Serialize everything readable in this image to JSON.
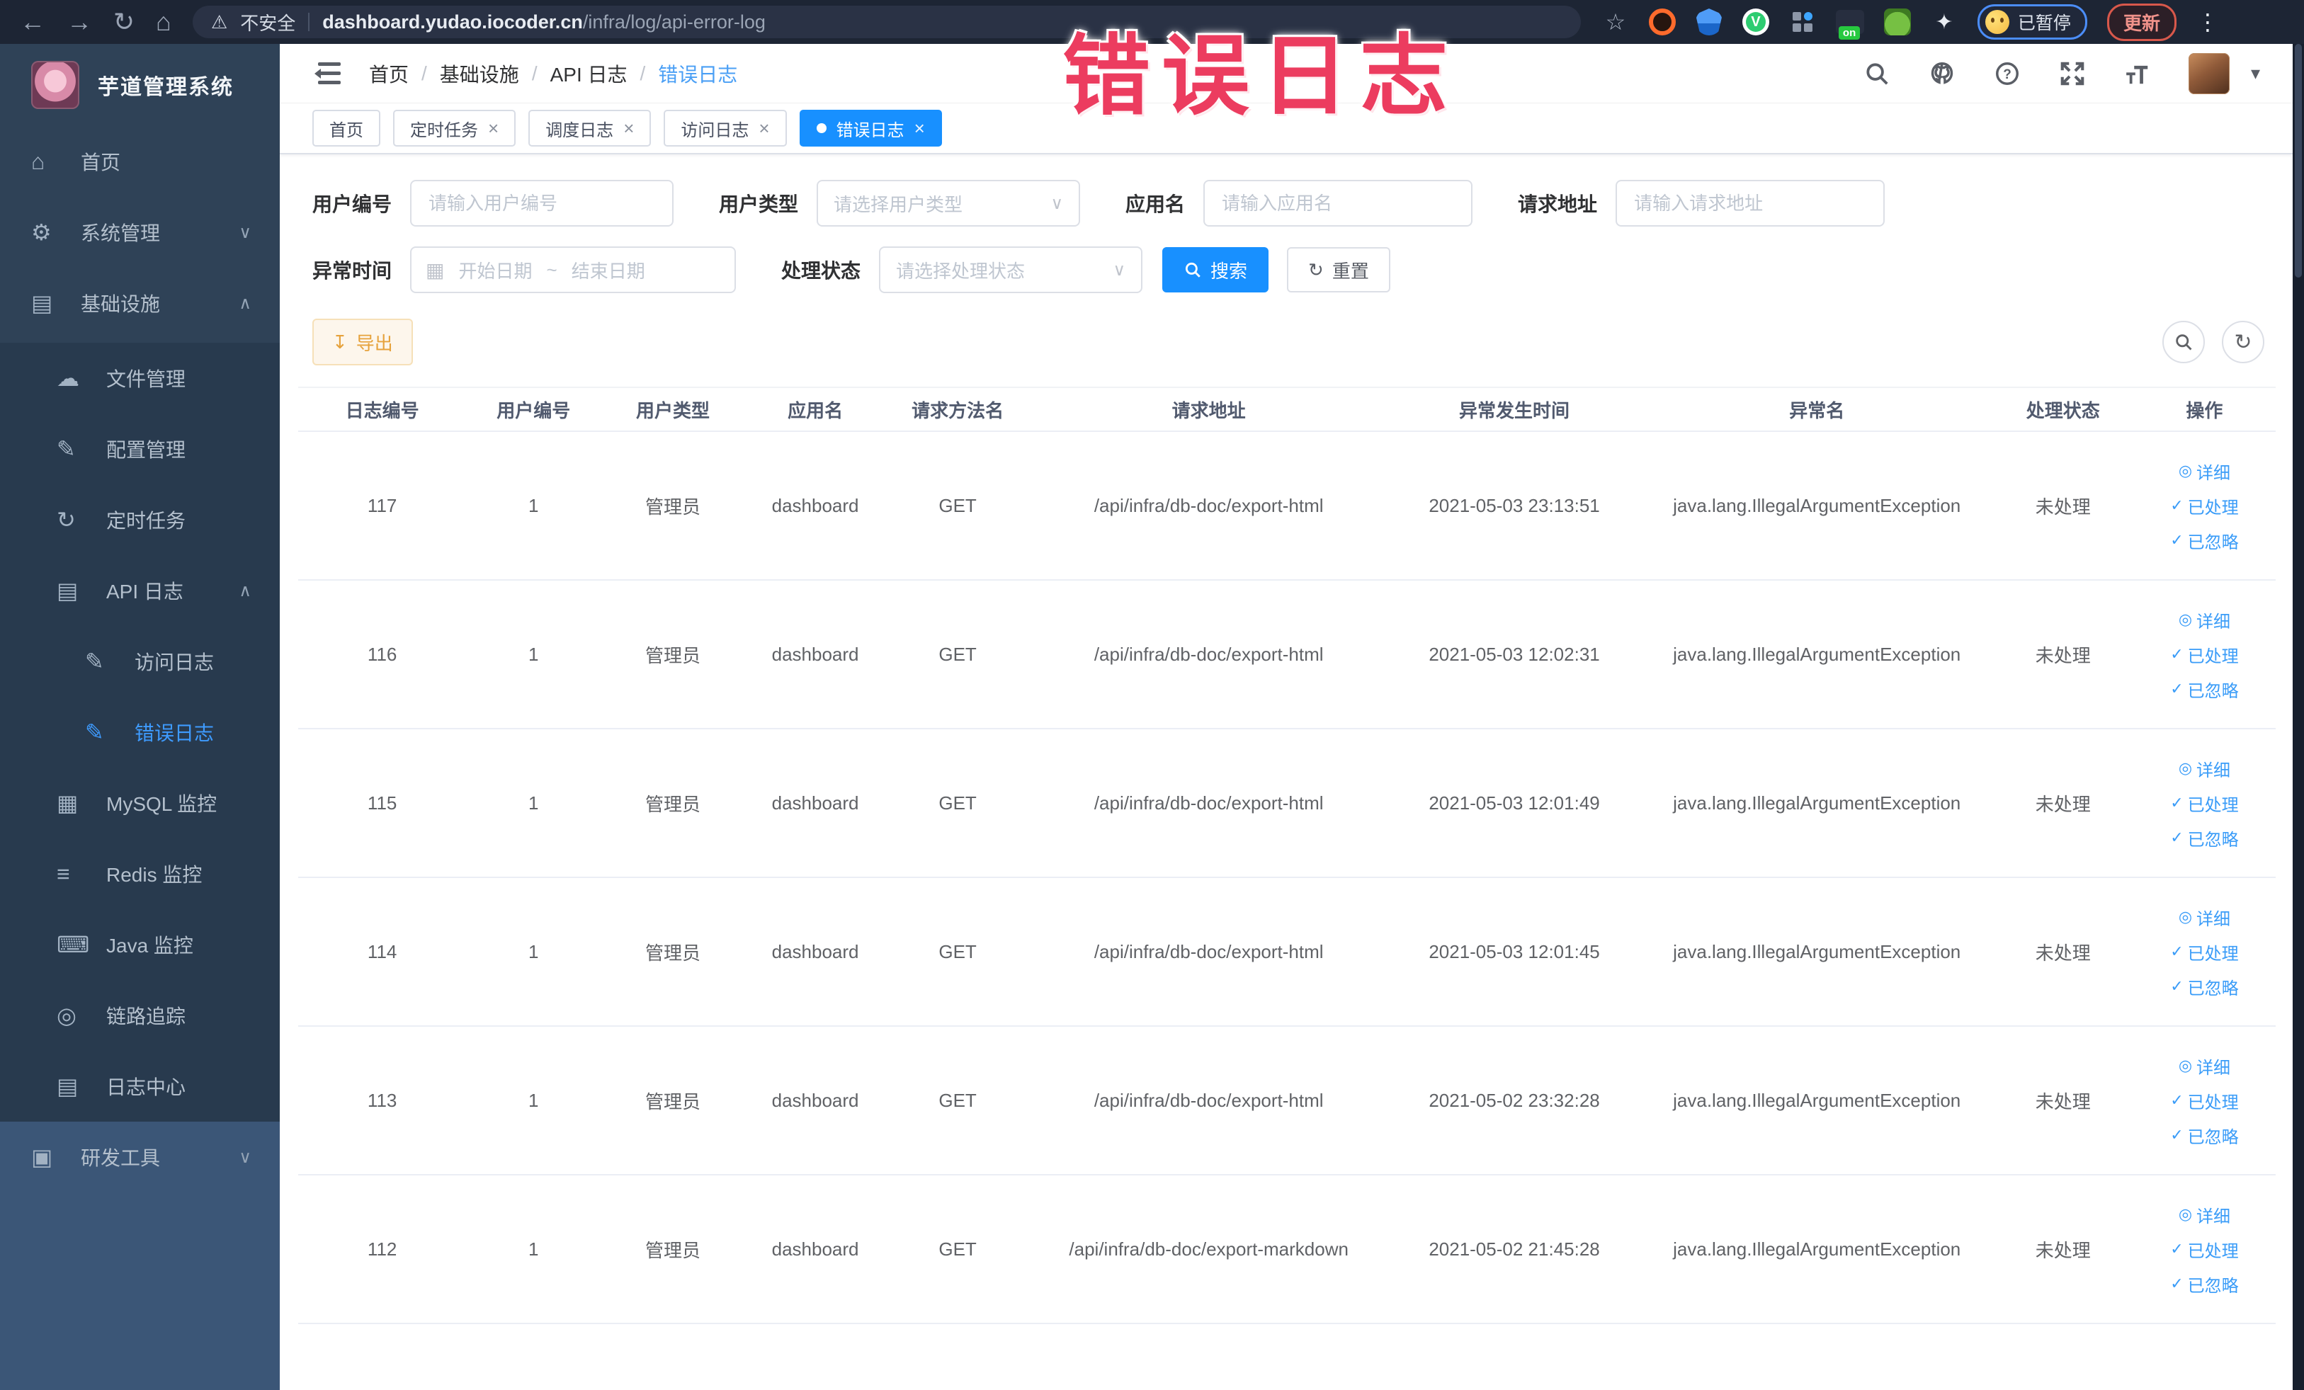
{
  "overlay": {
    "title": "错误日志",
    "color": "#ec3c5f"
  },
  "glyphs": {
    "back": "←",
    "forward": "→",
    "reload": "↻",
    "home": "⌂",
    "warning": "⚠",
    "star": "☆",
    "puzzle": "⚒",
    "menu_dots": "⋮",
    "caret_down": "▾",
    "close": "×",
    "check": "✓",
    "eye": "◎",
    "select_chevron": "∨",
    "calendar": "▦",
    "download": "↧",
    "refresh": "↻",
    "date_sep": "~",
    "question": "?",
    "on_badge": "on"
  },
  "browser": {
    "security_label": "不安全",
    "url_domain": "dashboard.yudao.iocoder.cn",
    "url_path": "/infra/log/api-error-log",
    "paused_badge": "已暂停",
    "update_button": "更新"
  },
  "sidebar": {
    "app_title": "芋道管理系统",
    "top_items": [
      {
        "label": "首页",
        "icon": "home-icon",
        "glyph": "⌂",
        "cls": "lvl0"
      },
      {
        "label": "系统管理",
        "icon": "gear-icon",
        "glyph": "⚙",
        "cls": "lvl0",
        "chev": "∨"
      },
      {
        "label": "基础设施",
        "icon": "infrastructure-icon",
        "glyph": "▤",
        "cls": "lvl0",
        "chev": "∧"
      }
    ],
    "sub_items": [
      {
        "label": "文件管理",
        "icon": "cloud-upload-icon",
        "glyph": "☁",
        "cls": "lvl1"
      },
      {
        "label": "配置管理",
        "icon": "config-edit-icon",
        "glyph": "✎",
        "cls": "lvl1"
      },
      {
        "label": "定时任务",
        "icon": "timer-task-icon",
        "glyph": "↻",
        "cls": "lvl1"
      },
      {
        "label": "API 日志",
        "icon": "api-log-icon",
        "glyph": "▤",
        "cls": "lvl1",
        "chev": "∧"
      },
      {
        "label": "访问日志",
        "icon": "access-log-icon",
        "glyph": "✎",
        "cls": "lvl2"
      },
      {
        "label": "错误日志",
        "icon": "error-log-icon",
        "glyph": "✎",
        "cls": "lvl2 active"
      },
      {
        "label": "MySQL 监控",
        "icon": "mysql-monitor-icon",
        "glyph": "▦",
        "cls": "lvl1"
      },
      {
        "label": "Redis 监控",
        "icon": "redis-monitor-icon",
        "glyph": "≡",
        "cls": "lvl1"
      },
      {
        "label": "Java 监控",
        "icon": "java-monitor-icon",
        "glyph": "⌨",
        "cls": "lvl1"
      },
      {
        "label": "链路追踪",
        "icon": "trace-eye-icon",
        "glyph": "◎",
        "cls": "lvl1"
      },
      {
        "label": "日志中心",
        "icon": "log-center-icon",
        "glyph": "▤",
        "cls": "lvl1"
      }
    ],
    "bottom_items": [
      {
        "label": "研发工具",
        "icon": "dev-tools-icon",
        "glyph": "▣",
        "cls": "lvl0",
        "chev": "∨"
      }
    ]
  },
  "breadcrumb": [
    {
      "label": "首页",
      "sep": true
    },
    {
      "label": "基础设施",
      "sep": true
    },
    {
      "label": "API 日志",
      "sep": true
    },
    {
      "label": "错误日志",
      "cls": "current",
      "sep": false
    }
  ],
  "tabs": [
    {
      "label": "首页",
      "closable": false,
      "dot": false,
      "cls": ""
    },
    {
      "label": "定时任务",
      "closable": true,
      "dot": false,
      "cls": ""
    },
    {
      "label": "调度日志",
      "closable": true,
      "dot": false,
      "cls": ""
    },
    {
      "label": "访问日志",
      "closable": true,
      "dot": false,
      "cls": ""
    },
    {
      "label": "错误日志",
      "closable": true,
      "dot": true,
      "cls": "active"
    }
  ],
  "filters": {
    "user_id_label": "用户编号",
    "user_id_placeholder": "请输入用户编号",
    "user_type_label": "用户类型",
    "user_type_placeholder": "请选择用户类型",
    "app_name_label": "应用名",
    "app_name_placeholder": "请输入应用名",
    "request_url_label": "请求地址",
    "request_url_placeholder": "请输入请求地址",
    "exception_time_label": "异常时间",
    "date_start_placeholder": "开始日期",
    "date_end_placeholder": "结束日期",
    "process_status_label": "处理状态",
    "process_status_placeholder": "请选择处理状态",
    "search_button": "搜索",
    "reset_button": "重置"
  },
  "toolbar": {
    "export_button": "导出"
  },
  "table": {
    "headers": [
      "日志编号",
      "用户编号",
      "用户类型",
      "应用名",
      "请求方法名",
      "请求地址",
      "异常发生时间",
      "异常名",
      "处理状态",
      "操作"
    ],
    "actions": [
      "详细",
      "已处理",
      "已忽略"
    ],
    "rows": [
      {
        "id": "117",
        "user_id": "1",
        "user_type": "管理员",
        "app": "dashboard",
        "method": "GET",
        "url": "/api/infra/db-doc/export-html",
        "time": "2021-05-03 23:13:51",
        "exception": "java.lang.IllegalArgumentException",
        "status": "未处理"
      },
      {
        "id": "116",
        "user_id": "1",
        "user_type": "管理员",
        "app": "dashboard",
        "method": "GET",
        "url": "/api/infra/db-doc/export-html",
        "time": "2021-05-03 12:02:31",
        "exception": "java.lang.IllegalArgumentException",
        "status": "未处理"
      },
      {
        "id": "115",
        "user_id": "1",
        "user_type": "管理员",
        "app": "dashboard",
        "method": "GET",
        "url": "/api/infra/db-doc/export-html",
        "time": "2021-05-03 12:01:49",
        "exception": "java.lang.IllegalArgumentException",
        "status": "未处理"
      },
      {
        "id": "114",
        "user_id": "1",
        "user_type": "管理员",
        "app": "dashboard",
        "method": "GET",
        "url": "/api/infra/db-doc/export-html",
        "time": "2021-05-03 12:01:45",
        "exception": "java.lang.IllegalArgumentException",
        "status": "未处理"
      },
      {
        "id": "113",
        "user_id": "1",
        "user_type": "管理员",
        "app": "dashboard",
        "method": "GET",
        "url": "/api/infra/db-doc/export-html",
        "time": "2021-05-02 23:32:28",
        "exception": "java.lang.IllegalArgumentException",
        "status": "未处理"
      },
      {
        "id": "112",
        "user_id": "1",
        "user_type": "管理员",
        "app": "dashboard",
        "method": "GET",
        "url": "/api/infra/db-doc/export-markdown",
        "time": "2021-05-02 21:45:28",
        "exception": "java.lang.IllegalArgumentException",
        "status": "未处理"
      }
    ]
  }
}
